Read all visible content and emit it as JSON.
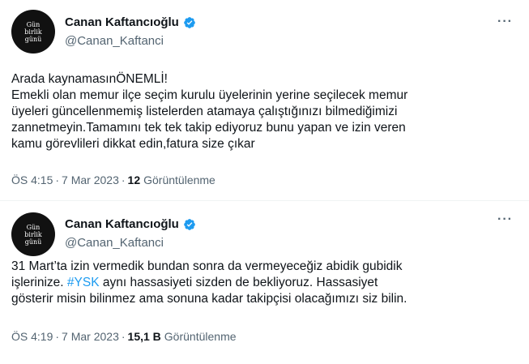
{
  "tweets": [
    {
      "avatar_text": [
        "Gün",
        "birlik",
        "günü"
      ],
      "name": "Canan Kaftancıoğlu",
      "handle": "@Canan_Kaftanci",
      "more_icon": "more-icon",
      "lines": [
        "Arada kaynamasınÖNEMLİ!",
        "Emekli olan memur ilçe seçim kurulu üyelerinin yerine seçilecek memur",
        "üyeleri güncellenmemiş listelerden atamaya çalıştığınızı bilmediğimizi",
        "zannetmeyin.Tamamını tek tek takip ediyoruz bunu yapan ve izin veren",
        "kamu görevlileri dikkat edin,fatura size çıkar"
      ],
      "time": "ÖS 4:15",
      "date": "7 Mar 2023",
      "views_count": "12",
      "views_label": "Görüntülenme"
    },
    {
      "avatar_text": [
        "Gün",
        "birlik",
        "günü"
      ],
      "name": "Canan Kaftancıoğlu",
      "handle": "@Canan_Kaftanci",
      "more_icon": "more-icon",
      "line1": "31 Mart’ta izin vermedik bundan sonra da vermeyeceğiz abidik gubidik",
      "line2_before": "işlerinize. ",
      "line2_hashtag": "#YSK",
      "line2_after": " aynı hassasiyeti sizden de bekliyoruz. Hassasiyet",
      "line3": "gösterir misin bilinmez ama sonuna kadar takipçisi olacağımızı siz bilin.",
      "time": "ÖS 4:19",
      "date": "7 Mar 2023",
      "views_count": "15,1 B",
      "views_label": "Görüntülenme"
    }
  ],
  "colors": {
    "text": "#0f1419",
    "secondary": "#536471",
    "accent": "#1d9bf0",
    "avatar_bg": "#111111"
  }
}
